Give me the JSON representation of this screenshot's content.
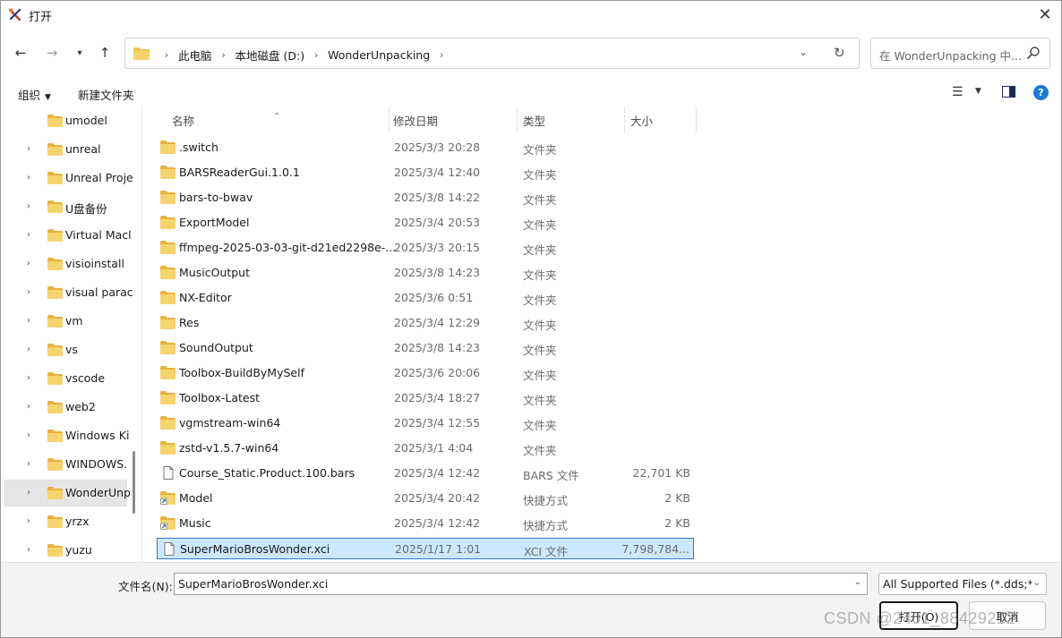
{
  "window": {
    "title": "打开"
  },
  "nav": {
    "back_icon": "arrow-left-icon",
    "forward_icon": "arrow-right-icon",
    "recent_icon": "chevron-down-icon",
    "up_icon": "arrow-up-icon",
    "breadcrumbs": [
      "此电脑",
      "本地磁盘 (D:)",
      "WonderUnpacking"
    ],
    "search_placeholder": "在 WonderUnpacking 中..."
  },
  "commandbar": {
    "organize_label": "组织",
    "new_folder_label": "新建文件夹"
  },
  "tree": [
    {
      "label": "umodel",
      "has_chevron": false
    },
    {
      "label": "unreal",
      "has_chevron": true
    },
    {
      "label": "Unreal Proje",
      "has_chevron": true
    },
    {
      "label": "U盘备份",
      "has_chevron": true
    },
    {
      "label": "Virtual Macl",
      "has_chevron": true
    },
    {
      "label": "visioinstall",
      "has_chevron": true
    },
    {
      "label": "visual parac",
      "has_chevron": true
    },
    {
      "label": "vm",
      "has_chevron": true
    },
    {
      "label": "vs",
      "has_chevron": true
    },
    {
      "label": "vscode",
      "has_chevron": true
    },
    {
      "label": "web2",
      "has_chevron": true
    },
    {
      "label": "Windows Ki",
      "has_chevron": true
    },
    {
      "label": "WINDOWS.",
      "has_chevron": true
    },
    {
      "label": "WonderUnp",
      "has_chevron": true,
      "selected": true
    },
    {
      "label": "yrzx",
      "has_chevron": true
    },
    {
      "label": "yuzu",
      "has_chevron": true
    }
  ],
  "columns": {
    "name": "名称",
    "date": "修改日期",
    "type": "类型",
    "size": "大小"
  },
  "files": [
    {
      "name": ".switch",
      "date": "2025/3/3 20:28",
      "type": "文件夹",
      "size": "",
      "icon": "folder"
    },
    {
      "name": "BARSReaderGui.1.0.1",
      "date": "2025/3/4 12:40",
      "type": "文件夹",
      "size": "",
      "icon": "folder"
    },
    {
      "name": "bars-to-bwav",
      "date": "2025/3/8 14:22",
      "type": "文件夹",
      "size": "",
      "icon": "folder"
    },
    {
      "name": "ExportModel",
      "date": "2025/3/4 20:53",
      "type": "文件夹",
      "size": "",
      "icon": "folder"
    },
    {
      "name": "ffmpeg-2025-03-03-git-d21ed2298e-...",
      "date": "2025/3/3 20:15",
      "type": "文件夹",
      "size": "",
      "icon": "folder"
    },
    {
      "name": "MusicOutput",
      "date": "2025/3/8 14:23",
      "type": "文件夹",
      "size": "",
      "icon": "folder"
    },
    {
      "name": "NX-Editor",
      "date": "2025/3/6 0:51",
      "type": "文件夹",
      "size": "",
      "icon": "folder"
    },
    {
      "name": "Res",
      "date": "2025/3/4 12:29",
      "type": "文件夹",
      "size": "",
      "icon": "folder"
    },
    {
      "name": "SoundOutput",
      "date": "2025/3/8 14:23",
      "type": "文件夹",
      "size": "",
      "icon": "folder"
    },
    {
      "name": "Toolbox-BuildByMySelf",
      "date": "2025/3/6 20:06",
      "type": "文件夹",
      "size": "",
      "icon": "folder"
    },
    {
      "name": "Toolbox-Latest",
      "date": "2025/3/4 18:27",
      "type": "文件夹",
      "size": "",
      "icon": "folder"
    },
    {
      "name": "vgmstream-win64",
      "date": "2025/3/4 12:55",
      "type": "文件夹",
      "size": "",
      "icon": "folder"
    },
    {
      "name": "zstd-v1.5.7-win64",
      "date": "2025/3/1 4:04",
      "type": "文件夹",
      "size": "",
      "icon": "folder"
    },
    {
      "name": "Course_Static.Product.100.bars",
      "date": "2025/3/4 12:42",
      "type": "BARS 文件",
      "size": "22,701 KB",
      "icon": "file"
    },
    {
      "name": "Model",
      "date": "2025/3/4 20:42",
      "type": "快捷方式",
      "size": "2 KB",
      "icon": "shortcut"
    },
    {
      "name": "Music",
      "date": "2025/3/4 12:42",
      "type": "快捷方式",
      "size": "2 KB",
      "icon": "shortcut"
    },
    {
      "name": "SuperMarioBrosWonder.xci",
      "date": "2025/1/17 1:01",
      "type": "XCI 文件",
      "size": "7,798,784...",
      "icon": "file",
      "selected": true
    }
  ],
  "footer": {
    "filename_label": "文件名(N):",
    "filename_value": "SuperMarioBrosWonder.xci",
    "filter_value": "All Supported Files (*.dds;*.a",
    "open_label": "打开(O)",
    "cancel_label": "取消"
  },
  "watermark": "CSDN @2401_88429212",
  "colors": {
    "folder": "#f2c14e",
    "selection": "#cce8ff",
    "selection_border": "#2b7bd4",
    "help": "#1f7ad6"
  }
}
